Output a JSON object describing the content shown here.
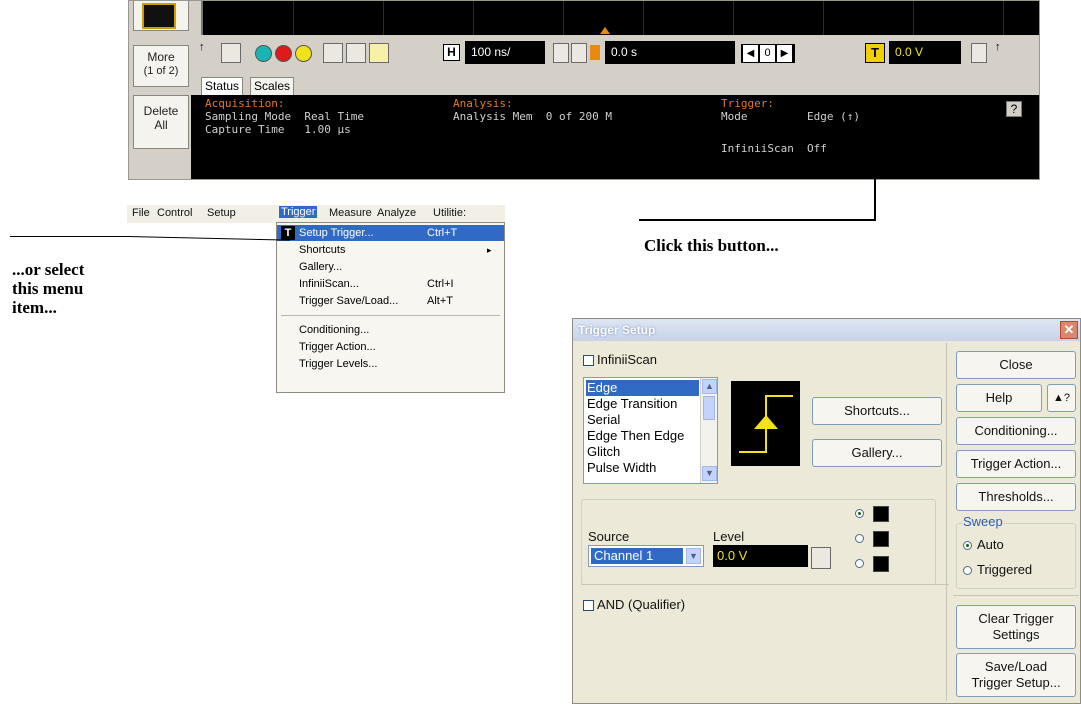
{
  "scope": {
    "side_buttons": {
      "more": "More",
      "more_sub": "(1 of 2)",
      "delete": "Delete",
      "delete_sub": "All"
    },
    "toolbar": {
      "h_icon": "H",
      "timebase": "100 ns/",
      "delay": "0.0 s",
      "nav_left": "◀",
      "nav_value": "0",
      "nav_right": "▶",
      "trigger_icon": "T",
      "trigger_level": "0.0 V"
    },
    "tabs": [
      "Status",
      "Scales"
    ],
    "status": {
      "acq_header": "Acquisition:",
      "acq_row1": "Sampling Mode  Real Time",
      "acq_row2": "Capture Time   1.00 µs",
      "ana_header": "Analysis:",
      "ana_row1": "Analysis Mem  0 of 200 M",
      "trg_header": "Trigger:",
      "trg_mode_label": "Mode",
      "trg_mode_value": "Edge (↑)",
      "trg_scan_label": "InfiniiScan",
      "trg_scan_value": "Off",
      "help": "?"
    },
    "colors": {
      "ch1": "#19b4b4",
      "ch2": "#e01919",
      "ch3": "#f2e21a",
      "marker": "#e88a12",
      "status_header": "#e0792a"
    }
  },
  "menu": {
    "bar": [
      "File",
      "Control",
      "Setup",
      "Trigger",
      "Measure",
      "Analyze",
      "Utilitie:"
    ],
    "selected": "Trigger",
    "items": [
      {
        "label": "Setup Trigger...",
        "shortcut": "Ctrl+T"
      },
      {
        "label": "Shortcuts",
        "shortcut": "▸"
      },
      {
        "label": "Gallery...",
        "shortcut": ""
      },
      {
        "label": "InfiniiScan...",
        "shortcut": "Ctrl+I"
      },
      {
        "label": "Trigger Save/Load...",
        "shortcut": "Alt+T"
      },
      {
        "label": "Conditioning...",
        "shortcut": ""
      },
      {
        "label": "Trigger Action...",
        "shortcut": ""
      },
      {
        "label": "Trigger Levels...",
        "shortcut": ""
      }
    ],
    "menu_icon": "T"
  },
  "callouts": {
    "button": "Click this button...",
    "menu_line1": "...or select",
    "menu_line2": "this menu",
    "menu_line3": "item..."
  },
  "dialog": {
    "title": "Trigger Setup",
    "close_x": "✕",
    "infiniiscan": "InfiniiScan",
    "trigger_types": [
      "Edge",
      "Edge Transition",
      "Serial",
      "Edge Then Edge",
      "Glitch",
      "Pulse Width"
    ],
    "buttons": {
      "shortcuts": "Shortcuts...",
      "gallery": "Gallery...",
      "close": "Close",
      "help": "Help",
      "whats_this": "▲?",
      "conditioning": "Conditioning...",
      "trigger_action": "Trigger Action...",
      "thresholds": "Thresholds...",
      "clear1": "Clear Trigger",
      "clear2": "Settings",
      "saveload1": "Save/Load",
      "saveload2": "Trigger Setup..."
    },
    "source_label": "Source",
    "source_value": "Channel 1",
    "level_label": "Level",
    "level_value": "0.0 V",
    "and_qualifier": "AND (Qualifier)",
    "sweep": {
      "label": "Sweep",
      "auto": "Auto",
      "triggered": "Triggered",
      "selected": "Auto"
    }
  }
}
